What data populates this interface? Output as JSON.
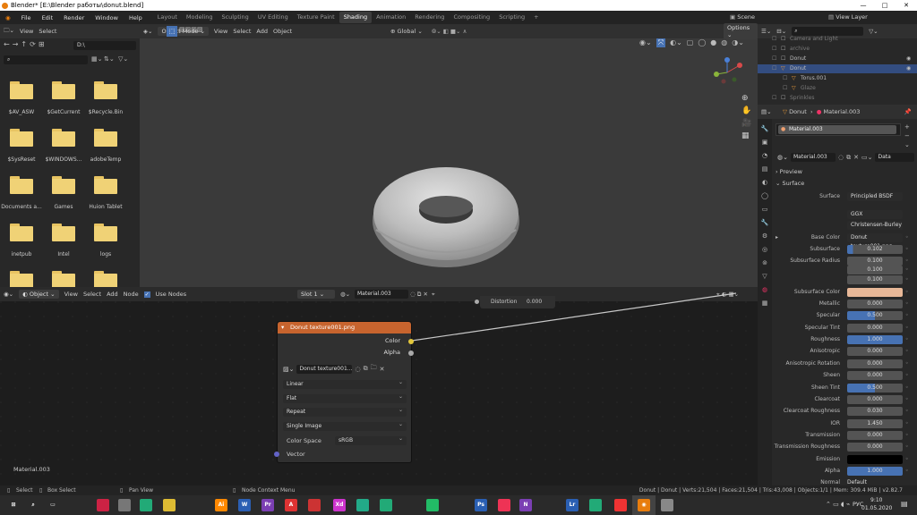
{
  "window": {
    "title": "Blender* [E:\\Blender работы\\donut.blend]",
    "minimize": "—",
    "maximize": "□",
    "close": "✕"
  },
  "menu": {
    "items": [
      "File",
      "Edit",
      "Render",
      "Window",
      "Help"
    ],
    "workspaces": [
      "Layout",
      "Modeling",
      "Sculpting",
      "UV Editing",
      "Texture Paint",
      "Shading",
      "Animation",
      "Rendering",
      "Compositing",
      "Scripting",
      "+"
    ],
    "active_workspace": "Shading",
    "scene": "Scene",
    "view_layer": "View Layer"
  },
  "file_browser": {
    "header": [
      "View",
      "Select"
    ],
    "path": "D:\\",
    "items": [
      "$AV_ASW",
      "$GetCurrent",
      "$Recycle.Bin",
      "$SysReset",
      "$WINDOWS...",
      "adobeTemp",
      "Documents a...",
      "Games",
      "Huion Tablet",
      "inetpub",
      "Intel",
      "logs",
      "",
      "",
      ""
    ]
  },
  "viewport": {
    "mode": "Object Mode",
    "menus": [
      "View",
      "Select",
      "Add",
      "Object"
    ],
    "orientation": "Global",
    "options": "Options"
  },
  "outliner": {
    "items": [
      {
        "label": "Camera and Light"
      },
      {
        "label": "archive"
      },
      {
        "label": "Donut"
      },
      {
        "label": "Donut"
      },
      {
        "label": "Torus.001"
      },
      {
        "label": "Glaze"
      },
      {
        "label": "Sprinkles"
      }
    ]
  },
  "properties": {
    "breadcrumb_object": "Donut",
    "breadcrumb_material": "Material.003",
    "slot_material": "Material.003",
    "material_field": "Material.003",
    "data_dropdown": "Data",
    "preview_label": "Preview",
    "surface_label": "Surface",
    "rows": [
      {
        "label": "Surface",
        "value": "Principled BSDF",
        "style": "dark"
      },
      {
        "label": "",
        "value": "GGX",
        "style": "plain"
      },
      {
        "label": "",
        "value": "Christensen-Burley",
        "style": "plain"
      },
      {
        "label": "Base Color",
        "value": "Donut texture001.png",
        "style": "dark"
      },
      {
        "label": "Subsurface",
        "value": "0.102",
        "style": "blue"
      },
      {
        "label": "Subsurface Radius",
        "value": "0.100",
        "style": "plain"
      },
      {
        "label": "",
        "value": "0.100",
        "style": "plain"
      },
      {
        "label": "",
        "value": "0.100",
        "style": "plain"
      },
      {
        "label": "Subsurface Color",
        "value": "",
        "style": "swatch"
      },
      {
        "label": "Metallic",
        "value": "0.000",
        "style": "plain"
      },
      {
        "label": "Specular",
        "value": "0.500",
        "style": "blue"
      },
      {
        "label": "Specular Tint",
        "value": "0.000",
        "style": "plain"
      },
      {
        "label": "Roughness",
        "value": "1.000",
        "style": "blue"
      },
      {
        "label": "Anisotropic",
        "value": "0.000",
        "style": "plain"
      },
      {
        "label": "Anisotropic Rotation",
        "value": "0.000",
        "style": "plain"
      },
      {
        "label": "Sheen",
        "value": "0.000",
        "style": "plain"
      },
      {
        "label": "Sheen Tint",
        "value": "0.500",
        "style": "blue"
      },
      {
        "label": "Clearcoat",
        "value": "0.000",
        "style": "plain"
      },
      {
        "label": "Clearcoat Roughness",
        "value": "0.030",
        "style": "plain"
      },
      {
        "label": "IOR",
        "value": "1.450",
        "style": "plain"
      },
      {
        "label": "Transmission",
        "value": "0.000",
        "style": "plain"
      },
      {
        "label": "Transmission Roughness",
        "value": "0.000",
        "style": "plain"
      },
      {
        "label": "Emission",
        "value": "",
        "style": "black"
      },
      {
        "label": "Alpha",
        "value": "1.000",
        "style": "blue"
      },
      {
        "label": "Normal",
        "value": "Default",
        "style": "text"
      }
    ],
    "subsurface_color": "#e8b898"
  },
  "node_editor": {
    "object_dropdown": "Object",
    "menus": [
      "View",
      "Select",
      "Add",
      "Node"
    ],
    "use_nodes": "Use Nodes",
    "slot": "Slot 1",
    "material": "Material.003",
    "material_label": "Material.003",
    "distortion_label": "Distortion",
    "distortion_value": "0.000",
    "node": {
      "title": "Donut texture001.png",
      "out_color": "Color",
      "out_alpha": "Alpha",
      "image_name": "Donut texture001...",
      "interpolation": "Linear",
      "projection": "Flat",
      "extension": "Repeat",
      "source": "Single Image",
      "color_space_label": "Color Space",
      "color_space": "sRGB",
      "vector": "Vector"
    }
  },
  "statusbar": {
    "select": "Select",
    "box_select": "Box Select",
    "pan_view": "Pan View",
    "context_menu": "Node Context Menu",
    "stats": "Donut | Donut | Verts:21,504 | Faces:21,504 | Tris:43,008 | Objects:1/1 | Mem: 309.4 MiB | v2.82.7"
  },
  "taskbar": {
    "lang": "РУС",
    "time": "9:10",
    "date": "01.05.2020"
  },
  "colors": {
    "accent_blue": "#4772b3",
    "node_header": "#c7642e",
    "folder": "#f0d276"
  }
}
